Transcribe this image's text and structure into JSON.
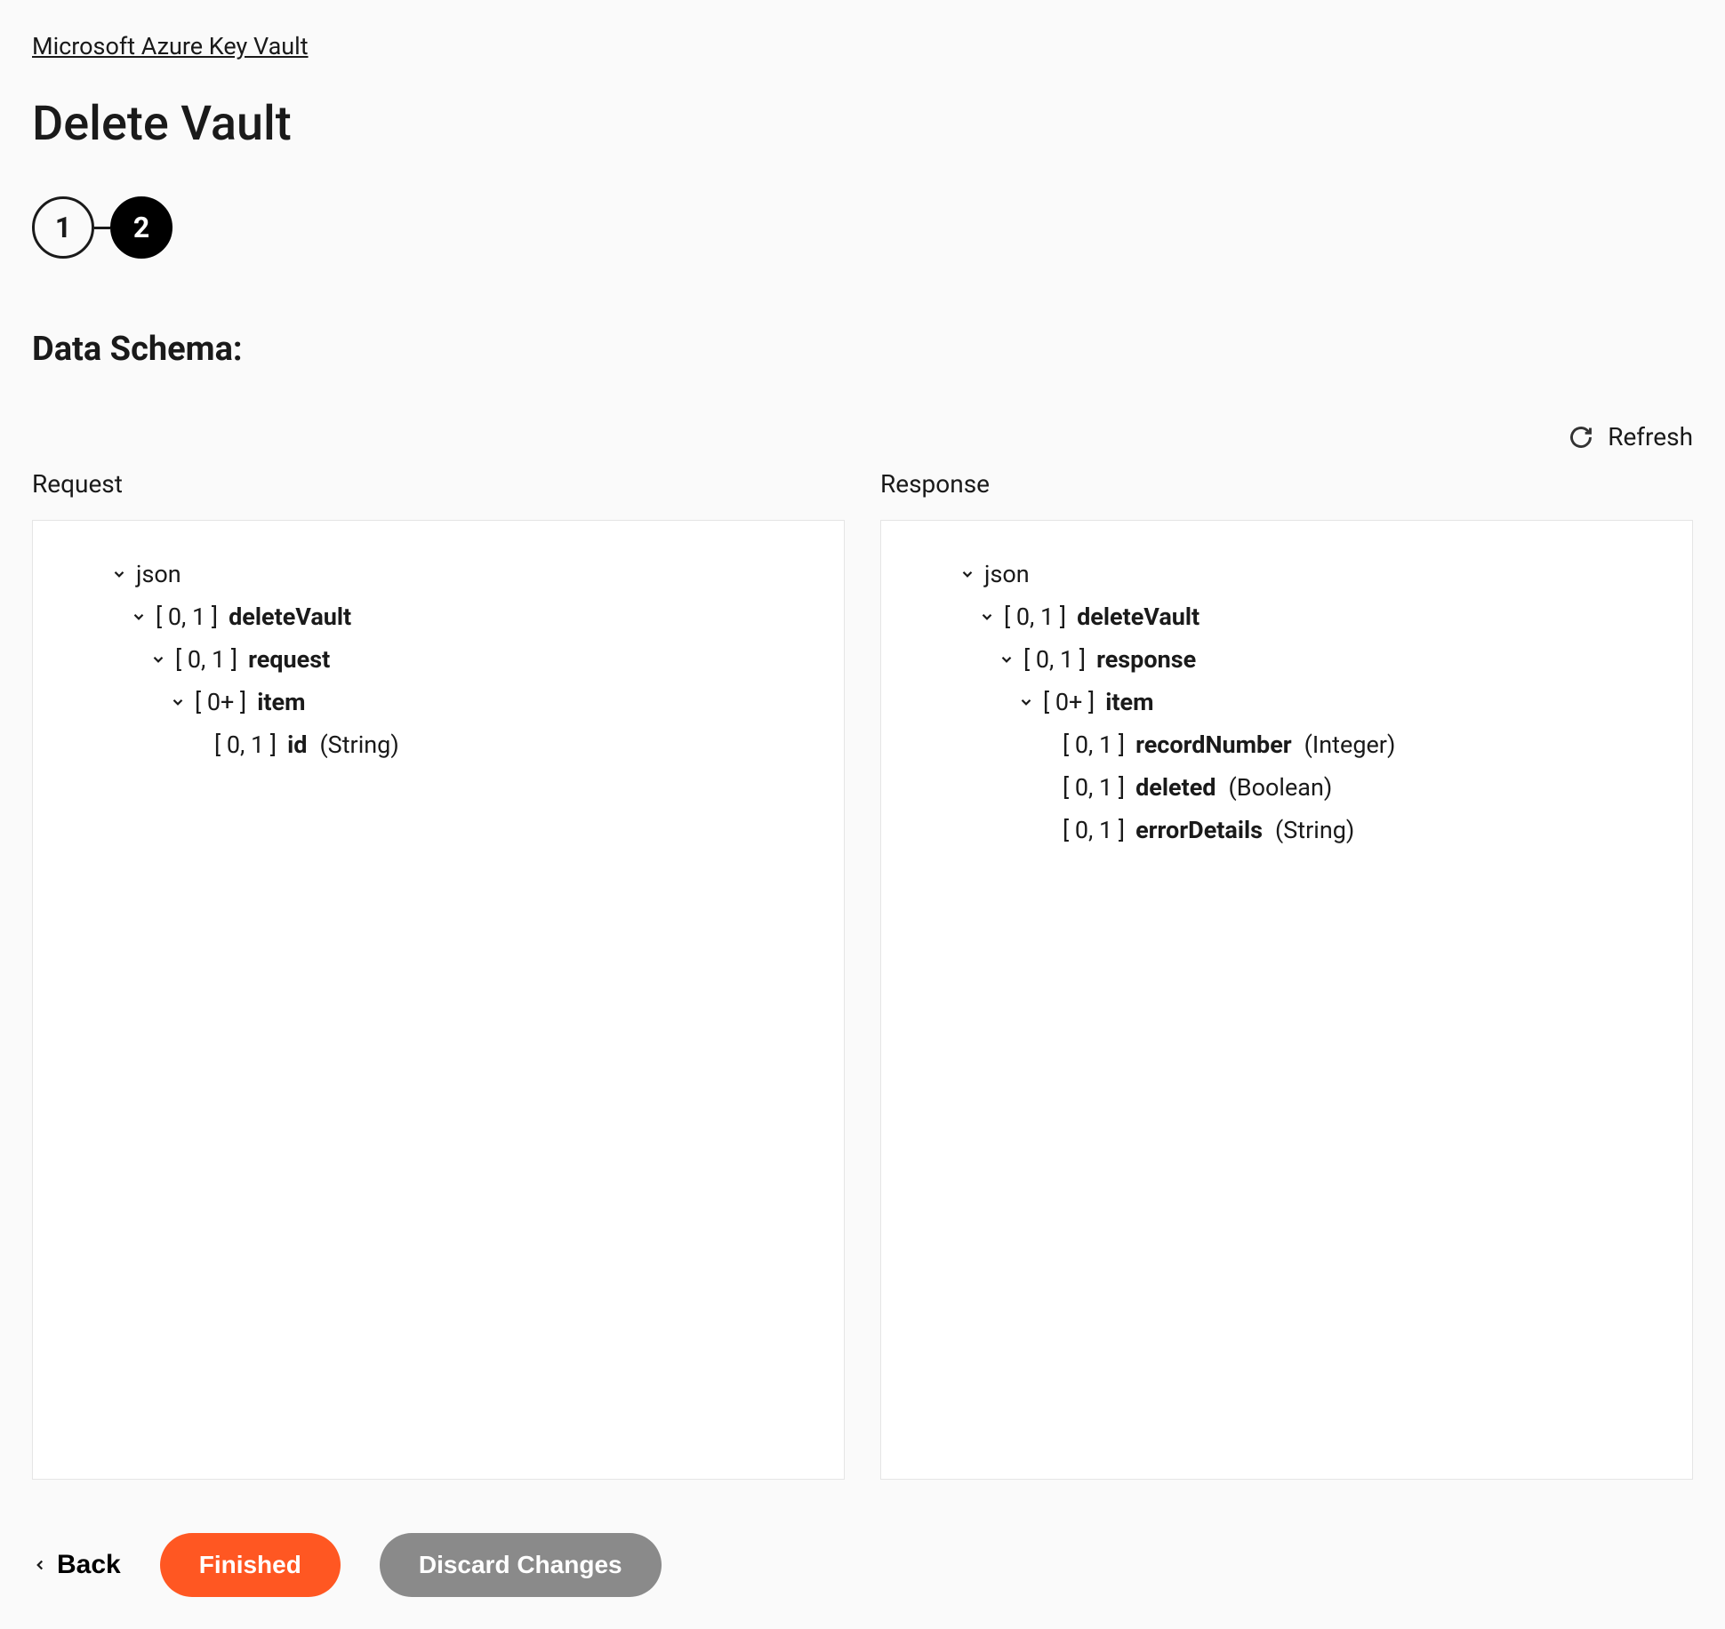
{
  "breadcrumb": "Microsoft Azure Key Vault",
  "page_title": "Delete Vault",
  "stepper": {
    "step1": "1",
    "step2": "2"
  },
  "section_heading": "Data Schema:",
  "refresh_label": "Refresh",
  "request_label": "Request",
  "response_label": "Response",
  "request_tree": {
    "root": "json",
    "n1_card": "[ 0, 1 ]",
    "n1_name": "deleteVault",
    "n2_card": "[ 0, 1 ]",
    "n2_name": "request",
    "n3_card": "[ 0+ ]",
    "n3_name": "item",
    "n4_card": "[ 0, 1 ]",
    "n4_name": "id",
    "n4_type": "(String)"
  },
  "response_tree": {
    "root": "json",
    "n1_card": "[ 0, 1 ]",
    "n1_name": "deleteVault",
    "n2_card": "[ 0, 1 ]",
    "n2_name": "response",
    "n3_card": "[ 0+ ]",
    "n3_name": "item",
    "n4_card": "[ 0, 1 ]",
    "n4_name": "recordNumber",
    "n4_type": "(Integer)",
    "n5_card": "[ 0, 1 ]",
    "n5_name": "deleted",
    "n5_type": "(Boolean)",
    "n6_card": "[ 0, 1 ]",
    "n6_name": "errorDetails",
    "n6_type": "(String)"
  },
  "footer": {
    "back": "Back",
    "finished": "Finished",
    "discard": "Discard Changes"
  }
}
